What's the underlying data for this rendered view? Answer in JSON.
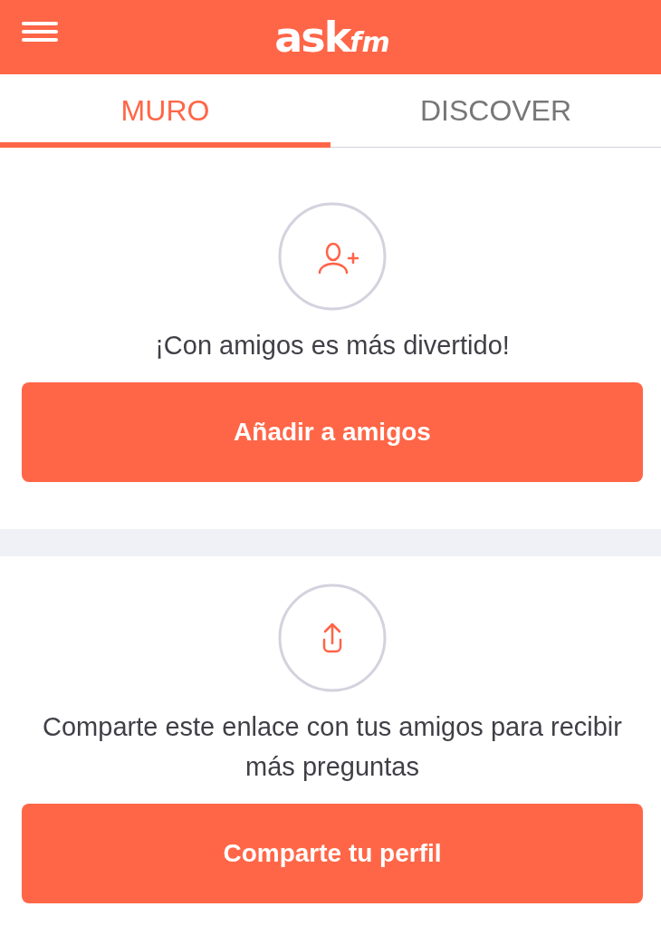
{
  "header": {
    "logo_main": "ask",
    "logo_accent": "fm"
  },
  "tabs": [
    {
      "label": "MURO",
      "selected": true
    },
    {
      "label": "DISCOVER",
      "selected": false
    }
  ],
  "cards": [
    {
      "kind": "add-friend",
      "message": "¡Con amigos es más divertido!",
      "button": "Añadir a amigos"
    },
    {
      "kind": "share",
      "message": "Comparte este enlace con tus amigos para recibir más preguntas",
      "button": "Comparte tu perfil"
    }
  ]
}
